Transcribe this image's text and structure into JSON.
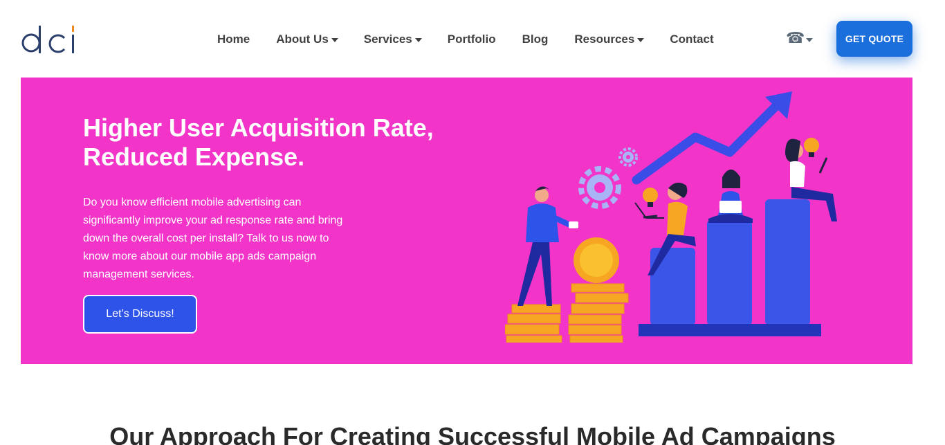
{
  "header": {
    "logo_text": "dci",
    "nav": [
      {
        "label": "Home",
        "dropdown": false
      },
      {
        "label": "About Us",
        "dropdown": true
      },
      {
        "label": "Services",
        "dropdown": true
      },
      {
        "label": "Portfolio",
        "dropdown": false
      },
      {
        "label": "Blog",
        "dropdown": false
      },
      {
        "label": "Resources",
        "dropdown": true
      },
      {
        "label": "Contact",
        "dropdown": false
      }
    ],
    "phone_icon": "phone-icon",
    "cta_label": "GET QUOTE"
  },
  "hero": {
    "title_line1": "Higher User Acquisition Rate,",
    "title_line2": "Reduced Expense.",
    "text": "Do you know efficient mobile advertising can significantly improve your ad response rate and bring down the overall cost per install? Talk to us now to know more about our mobile app ads campaign management services.",
    "button_label": "Let’s Discuss!"
  },
  "section": {
    "title": "Our Approach For Creating Successful Mobile Ad Campaigns"
  },
  "colors": {
    "hero_bg": "#f235c8",
    "primary_blue": "#1a6fdc",
    "cta_blue": "#2d53e8",
    "logo_blue": "#2b3f6c",
    "logo_orange": "#f08a1c"
  }
}
